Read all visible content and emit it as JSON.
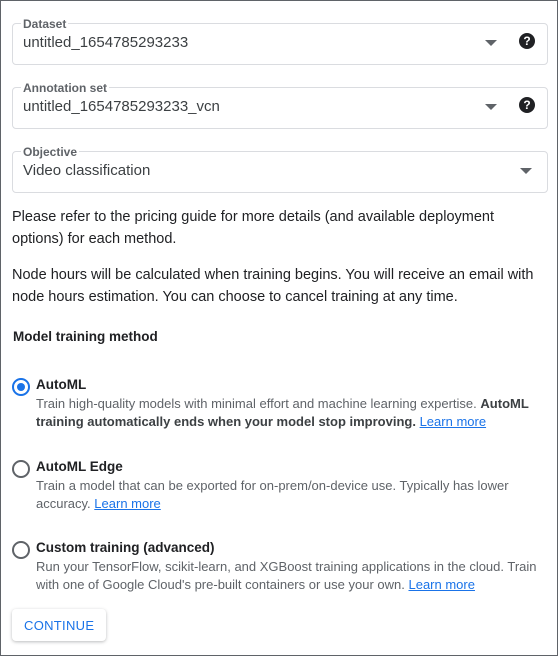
{
  "dataset": {
    "label": "Dataset",
    "value": "untitled_1654785293233",
    "help": "?"
  },
  "annotation_set": {
    "label": "Annotation set",
    "value": "untitled_1654785293233_vcn",
    "help": "?"
  },
  "objective": {
    "label": "Objective",
    "value": "Video classification"
  },
  "info": {
    "pricing": "Please refer to the pricing guide for more details (and available deployment options) for each method.",
    "node_hours": "Node hours will be calculated when training begins. You will receive an email with node hours estimation. You can choose to cancel training at any time."
  },
  "training_method": {
    "title": "Model training method",
    "selected": "automl",
    "options": [
      {
        "title": "AutoML",
        "desc": "Train high-quality models with minimal effort and machine learning expertise.",
        "desc_bold": "AutoML training automatically ends when your model stop improving.",
        "link": "Learn more"
      },
      {
        "title": "AutoML Edge",
        "desc": "Train a model that can be exported for on-prem/on-device use. Typically has lower accuracy.",
        "link": "Learn more"
      },
      {
        "title": "Custom training (advanced)",
        "desc": "Run your TensorFlow, scikit-learn, and XGBoost training applications in the cloud. Train with one of Google Cloud's pre-built containers or use your own.",
        "link": "Learn more"
      }
    ]
  },
  "continue_label": "CONTINUE"
}
